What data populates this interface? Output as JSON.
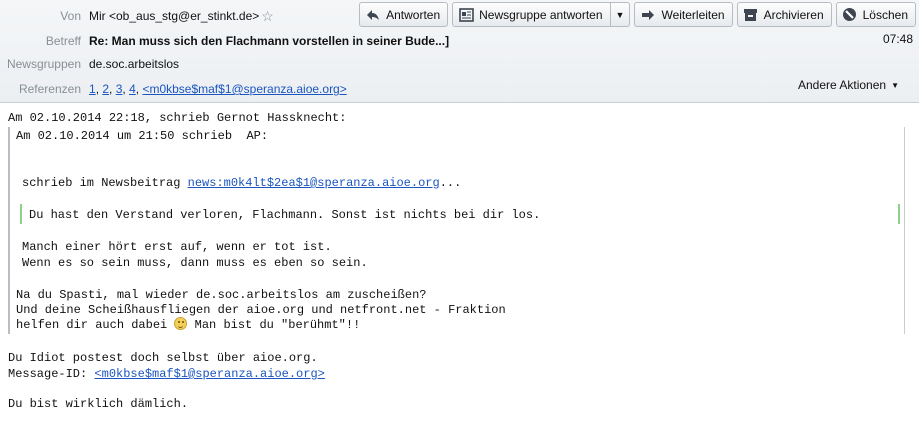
{
  "header": {
    "from_label": "Von",
    "from_value": "Mir <ob_aus_stg@er_stinkt.de>",
    "subject_label": "Betreff",
    "subject_value": "Re: Man muss sich den Flachmann vorstellen in seiner Bude...]",
    "time": "07:48",
    "newsgroups_label": "Newsgruppen",
    "newsgroups_value": "de.soc.arbeitslos",
    "references_label": "Referenzen",
    "references": [
      "1",
      "2",
      "3",
      "4",
      "<m0kbse$maf$1@speranza.aioe.org>"
    ],
    "other_actions": "Andere Aktionen"
  },
  "toolbar": {
    "reply": "Antworten",
    "reply_newsgroup": "Newsgruppe antworten",
    "forward": "Weiterleiten",
    "archive": "Archivieren",
    "delete": "Löschen"
  },
  "body": {
    "intro": "Am 02.10.2014 22:18, schrieb Gernot Hassknecht:",
    "quote_intro": "Am 02.10.2014 um 21:50 schrieb  AP:",
    "newsbeitrag_prefix": "schrieb im Newsbeitrag ",
    "newsbeitrag_link": "news:m0k4lt$2ea$1@speranza.aioe.org",
    "newsbeitrag_suffix": "...",
    "nested_quote": "Du hast den Verstand verloren, Flachmann. Sonst ist nichts bei dir los.",
    "line_a": "Manch einer hört erst auf, wenn er tot ist.",
    "line_b": "Wenn es so sein muss, dann muss es eben so sein.",
    "line_c": "Na du Spasti, mal wieder de.soc.arbeitslos am zuscheißen?",
    "line_d": "Und deine Scheißhausfliegen der aioe.org und netfront.net - Fraktion",
    "line_e_1": "helfen dir auch dabei ",
    "line_e_2": " Man bist du \"berühmt\"!!",
    "reply_1": "Du Idiot postest doch selbst über aioe.org.",
    "msgid_label": "Message-ID: ",
    "msgid_link": "<m0kbse$maf$1@speranza.aioe.org>",
    "reply_2": "Du bist wirklich dämlich."
  },
  "colors": {
    "link": "#1a55c0",
    "quote_bar": "#b9bec4",
    "nested_quote_bar": "#8bd08b",
    "header_bg": "#eef1f4"
  }
}
